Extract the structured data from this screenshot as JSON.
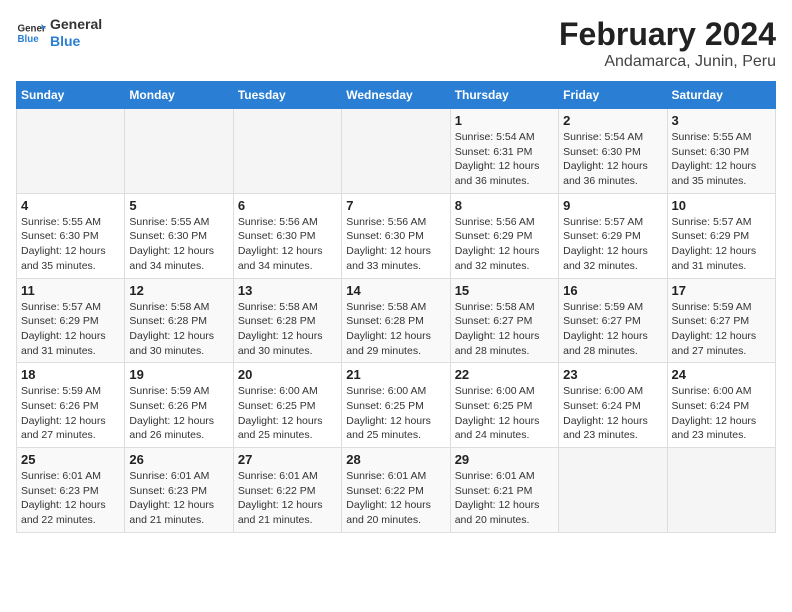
{
  "logo": {
    "general": "General",
    "blue": "Blue"
  },
  "title": "February 2024",
  "subtitle": "Andamarca, Junin, Peru",
  "days_of_week": [
    "Sunday",
    "Monday",
    "Tuesday",
    "Wednesday",
    "Thursday",
    "Friday",
    "Saturday"
  ],
  "weeks": [
    [
      {
        "day": "",
        "info": ""
      },
      {
        "day": "",
        "info": ""
      },
      {
        "day": "",
        "info": ""
      },
      {
        "day": "",
        "info": ""
      },
      {
        "day": "1",
        "info": "Sunrise: 5:54 AM\nSunset: 6:31 PM\nDaylight: 12 hours and 36 minutes."
      },
      {
        "day": "2",
        "info": "Sunrise: 5:54 AM\nSunset: 6:30 PM\nDaylight: 12 hours and 36 minutes."
      },
      {
        "day": "3",
        "info": "Sunrise: 5:55 AM\nSunset: 6:30 PM\nDaylight: 12 hours and 35 minutes."
      }
    ],
    [
      {
        "day": "4",
        "info": "Sunrise: 5:55 AM\nSunset: 6:30 PM\nDaylight: 12 hours and 35 minutes."
      },
      {
        "day": "5",
        "info": "Sunrise: 5:55 AM\nSunset: 6:30 PM\nDaylight: 12 hours and 34 minutes."
      },
      {
        "day": "6",
        "info": "Sunrise: 5:56 AM\nSunset: 6:30 PM\nDaylight: 12 hours and 34 minutes."
      },
      {
        "day": "7",
        "info": "Sunrise: 5:56 AM\nSunset: 6:30 PM\nDaylight: 12 hours and 33 minutes."
      },
      {
        "day": "8",
        "info": "Sunrise: 5:56 AM\nSunset: 6:29 PM\nDaylight: 12 hours and 32 minutes."
      },
      {
        "day": "9",
        "info": "Sunrise: 5:57 AM\nSunset: 6:29 PM\nDaylight: 12 hours and 32 minutes."
      },
      {
        "day": "10",
        "info": "Sunrise: 5:57 AM\nSunset: 6:29 PM\nDaylight: 12 hours and 31 minutes."
      }
    ],
    [
      {
        "day": "11",
        "info": "Sunrise: 5:57 AM\nSunset: 6:29 PM\nDaylight: 12 hours and 31 minutes."
      },
      {
        "day": "12",
        "info": "Sunrise: 5:58 AM\nSunset: 6:28 PM\nDaylight: 12 hours and 30 minutes."
      },
      {
        "day": "13",
        "info": "Sunrise: 5:58 AM\nSunset: 6:28 PM\nDaylight: 12 hours and 30 minutes."
      },
      {
        "day": "14",
        "info": "Sunrise: 5:58 AM\nSunset: 6:28 PM\nDaylight: 12 hours and 29 minutes."
      },
      {
        "day": "15",
        "info": "Sunrise: 5:58 AM\nSunset: 6:27 PM\nDaylight: 12 hours and 28 minutes."
      },
      {
        "day": "16",
        "info": "Sunrise: 5:59 AM\nSunset: 6:27 PM\nDaylight: 12 hours and 28 minutes."
      },
      {
        "day": "17",
        "info": "Sunrise: 5:59 AM\nSunset: 6:27 PM\nDaylight: 12 hours and 27 minutes."
      }
    ],
    [
      {
        "day": "18",
        "info": "Sunrise: 5:59 AM\nSunset: 6:26 PM\nDaylight: 12 hours and 27 minutes."
      },
      {
        "day": "19",
        "info": "Sunrise: 5:59 AM\nSunset: 6:26 PM\nDaylight: 12 hours and 26 minutes."
      },
      {
        "day": "20",
        "info": "Sunrise: 6:00 AM\nSunset: 6:25 PM\nDaylight: 12 hours and 25 minutes."
      },
      {
        "day": "21",
        "info": "Sunrise: 6:00 AM\nSunset: 6:25 PM\nDaylight: 12 hours and 25 minutes."
      },
      {
        "day": "22",
        "info": "Sunrise: 6:00 AM\nSunset: 6:25 PM\nDaylight: 12 hours and 24 minutes."
      },
      {
        "day": "23",
        "info": "Sunrise: 6:00 AM\nSunset: 6:24 PM\nDaylight: 12 hours and 23 minutes."
      },
      {
        "day": "24",
        "info": "Sunrise: 6:00 AM\nSunset: 6:24 PM\nDaylight: 12 hours and 23 minutes."
      }
    ],
    [
      {
        "day": "25",
        "info": "Sunrise: 6:01 AM\nSunset: 6:23 PM\nDaylight: 12 hours and 22 minutes."
      },
      {
        "day": "26",
        "info": "Sunrise: 6:01 AM\nSunset: 6:23 PM\nDaylight: 12 hours and 21 minutes."
      },
      {
        "day": "27",
        "info": "Sunrise: 6:01 AM\nSunset: 6:22 PM\nDaylight: 12 hours and 21 minutes."
      },
      {
        "day": "28",
        "info": "Sunrise: 6:01 AM\nSunset: 6:22 PM\nDaylight: 12 hours and 20 minutes."
      },
      {
        "day": "29",
        "info": "Sunrise: 6:01 AM\nSunset: 6:21 PM\nDaylight: 12 hours and 20 minutes."
      },
      {
        "day": "",
        "info": ""
      },
      {
        "day": "",
        "info": ""
      }
    ]
  ]
}
